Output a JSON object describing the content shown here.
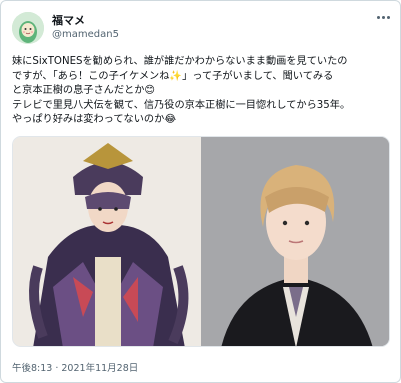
{
  "user": {
    "display_name": "福マメ",
    "handle": "@mamedan5"
  },
  "tweet": {
    "lines": [
      "妹にSixTONESを勧められ、誰が誰だかわからないまま動画を見ていたの",
      "ですが、「あら！この子イケメンね✨」って子がいまして、聞いてみる",
      "と京本正樹の息子さんだとか😊",
      "テレビで里見八犬伝を観て、信乃役の京本正樹に一目惚れしてから35年。",
      "やっぱり好みは変わってないのか😂"
    ]
  },
  "timestamp": "午後8:13 · 2021年11月28日",
  "icons": {
    "more": "more-options-icon",
    "avatar": "bean-character-avatar"
  },
  "colors": {
    "text": "#0f1419",
    "secondary": "#536471",
    "border": "#cfd9de"
  }
}
